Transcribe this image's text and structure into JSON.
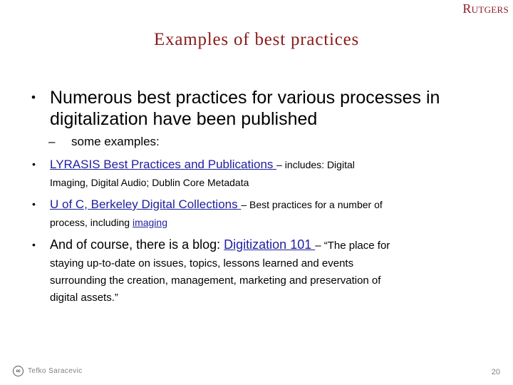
{
  "logo": {
    "text": "Rutgers"
  },
  "title": "Examples of best practices",
  "colors": {
    "title_red": "#8B1A1A",
    "logo_red": "#8C1D2A",
    "link_blue": "#1F1F9F",
    "footer_gray": "#808080",
    "background": "#ffffff"
  },
  "content": {
    "bullet_glyph": "•",
    "dash_glyph": "–",
    "bullet1": "Numerous best practices for various processes in digitalization have been published",
    "sub1": "some examples:",
    "item_lyrasis": {
      "link": "LYRASIS Best Practices and Publications ",
      "after": "– includes: Digital",
      "continuation": "Imaging, Digital Audio; Dublin Core Metadata"
    },
    "item_berkeley": {
      "link": "U of C, Berkeley Digital Collections ",
      "after": "– Best practices for a number of",
      "continuation_pre": "process, including ",
      "continuation_link": "imaging"
    },
    "item_blog": {
      "pre": "And of course, there is a blog: ",
      "link": "Digitization 101 ",
      "after": "– “The place for",
      "line2": "staying up-to-date on issues, topics, lessons learned and events",
      "line3": "surrounding the creation, management, marketing and preservation of",
      "line4": "digital assets.”"
    }
  },
  "footer": {
    "cc_icon_label": "cc",
    "credit": "Tefko Saracevic",
    "page_number": "20"
  }
}
